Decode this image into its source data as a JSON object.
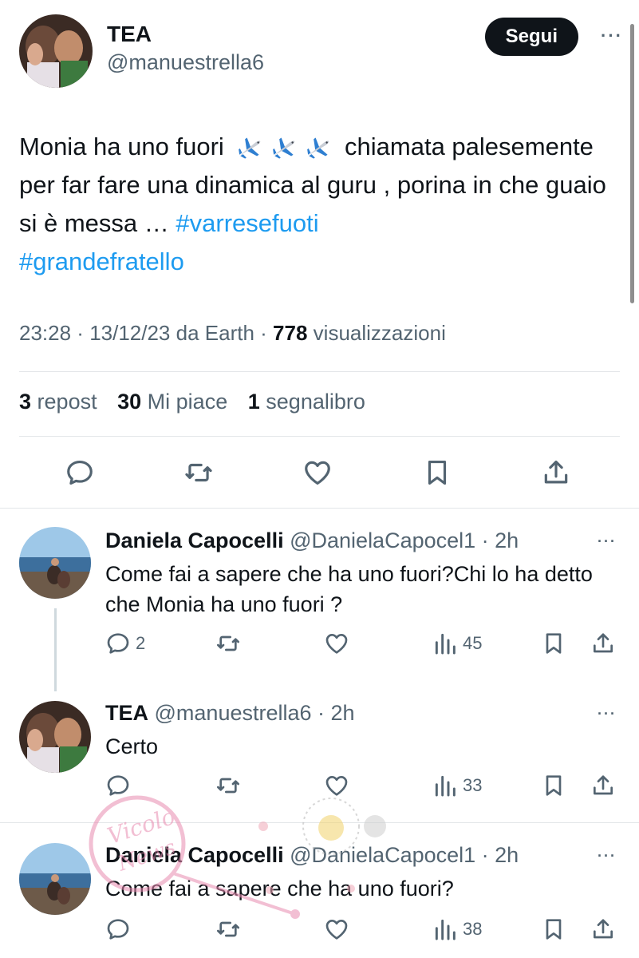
{
  "main_tweet": {
    "display_name": "TEA",
    "handle": "@manuestrella6",
    "follow_label": "Segui",
    "more_label": "···",
    "text_before": "Monia ha uno fuori",
    "emoji": "airplane",
    "text_after": " chiamata palesemente per far fare una dinamica al guru , porina in che guaio si è messa … ",
    "hashtag1": "#varresefuoti",
    "hashtag2": "#grandefratello",
    "time": "23:28",
    "date": "13/12/23",
    "source": "da Earth",
    "views": "778",
    "views_label": "visualizzazioni",
    "reposts": "3",
    "reposts_label": "repost",
    "likes": "30",
    "likes_label": "Mi piace",
    "bookmarks": "1",
    "bookmarks_label": "segnalibro"
  },
  "replies": [
    {
      "display_name": "Daniela Capocelli",
      "handle": "@DanielaCapocel1",
      "age": "2h",
      "text": "Come fai a sapere che ha uno fuori?Chi lo ha detto che Monia ha uno fuori ?",
      "reply_count": "2",
      "views": "45"
    },
    {
      "display_name": "TEA",
      "handle": "@manuestrella6",
      "age": "2h",
      "text": "Certo",
      "reply_count": "",
      "views": "33"
    },
    {
      "display_name": "Daniela Capocelli",
      "handle": "@DanielaCapocel1",
      "age": "2h",
      "text": "Come fai a sapere che ha uno fuori?",
      "reply_count": "",
      "views": "38"
    }
  ],
  "watermark": {
    "text": "Vicolo News"
  },
  "colors": {
    "accent": "#1d9bf0",
    "text": "#0f1419",
    "muted": "#536471",
    "divider": "#e3e6e9"
  },
  "icons": [
    "reply-icon",
    "repost-icon",
    "like-icon",
    "bookmark-icon",
    "share-icon",
    "views-icon",
    "airplane-icon",
    "more-icon"
  ]
}
